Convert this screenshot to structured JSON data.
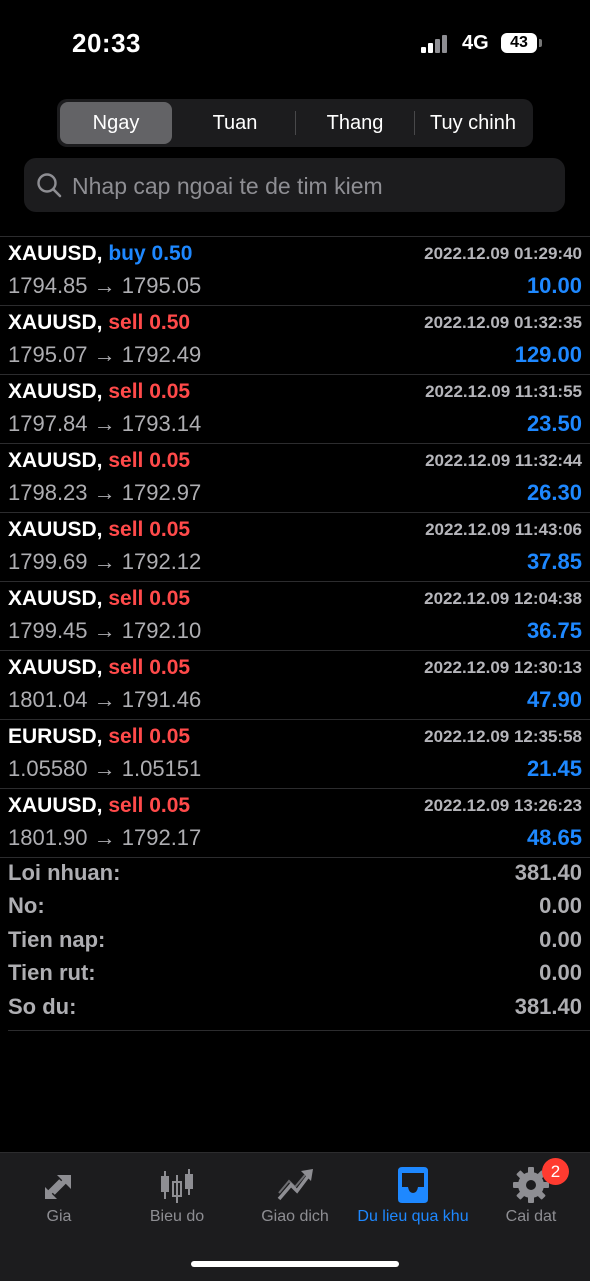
{
  "status_bar": {
    "time": "20:33",
    "network": "4G",
    "battery": "43"
  },
  "period_tabs": [
    {
      "label": "Ngay",
      "active": true
    },
    {
      "label": "Tuan",
      "active": false
    },
    {
      "label": "Thang",
      "active": false
    },
    {
      "label": "Tuy chinh",
      "active": false
    }
  ],
  "search": {
    "placeholder": "Nhap cap ngoai te de tim kiem"
  },
  "trades": [
    {
      "symbol": "XAUUSD,",
      "side": "buy 0.50",
      "side_type": "buy",
      "datetime": "2022.12.09 01:29:40",
      "prices": "1794.85 → 1795.05",
      "profit": "10.00"
    },
    {
      "symbol": "XAUUSD,",
      "side": "sell 0.50",
      "side_type": "sell",
      "datetime": "2022.12.09 01:32:35",
      "prices": "1795.07 → 1792.49",
      "profit": "129.00"
    },
    {
      "symbol": "XAUUSD,",
      "side": "sell 0.05",
      "side_type": "sell",
      "datetime": "2022.12.09 11:31:55",
      "prices": "1797.84 → 1793.14",
      "profit": "23.50"
    },
    {
      "symbol": "XAUUSD,",
      "side": "sell 0.05",
      "side_type": "sell",
      "datetime": "2022.12.09 11:32:44",
      "prices": "1798.23 → 1792.97",
      "profit": "26.30"
    },
    {
      "symbol": "XAUUSD,",
      "side": "sell 0.05",
      "side_type": "sell",
      "datetime": "2022.12.09 11:43:06",
      "prices": "1799.69 → 1792.12",
      "profit": "37.85"
    },
    {
      "symbol": "XAUUSD,",
      "side": "sell 0.05",
      "side_type": "sell",
      "datetime": "2022.12.09 12:04:38",
      "prices": "1799.45 → 1792.10",
      "profit": "36.75"
    },
    {
      "symbol": "XAUUSD,",
      "side": "sell 0.05",
      "side_type": "sell",
      "datetime": "2022.12.09 12:30:13",
      "prices": "1801.04 → 1791.46",
      "profit": "47.90"
    },
    {
      "symbol": "EURUSD,",
      "side": "sell 0.05",
      "side_type": "sell",
      "datetime": "2022.12.09 12:35:58",
      "prices": "1.05580 → 1.05151",
      "profit": "21.45"
    },
    {
      "symbol": "XAUUSD,",
      "side": "sell 0.05",
      "side_type": "sell",
      "datetime": "2022.12.09 13:26:23",
      "prices": "1801.90 → 1792.17",
      "profit": "48.65"
    }
  ],
  "summary": [
    {
      "label": "Loi nhuan:",
      "value": "381.40"
    },
    {
      "label": "No:",
      "value": "0.00"
    },
    {
      "label": "Tien nap:",
      "value": "0.00"
    },
    {
      "label": "Tien rut:",
      "value": "0.00"
    },
    {
      "label": "So du:",
      "value": "381.40"
    }
  ],
  "tab_bar": [
    {
      "label": "Gia",
      "icon": "arrows-icon",
      "active": false
    },
    {
      "label": "Bieu do",
      "icon": "candlestick-icon",
      "active": false
    },
    {
      "label": "Giao dich",
      "icon": "trend-icon",
      "active": false
    },
    {
      "label": "Du lieu qua khu",
      "icon": "inbox-icon",
      "active": true
    },
    {
      "label": "Cai dat",
      "icon": "gear-icon",
      "active": false
    }
  ],
  "settings_badge": "2",
  "colors": {
    "buy": "#1e88ff",
    "sell": "#ff4a4a",
    "profit": "#1e88ff",
    "active_tab": "#1e88ff",
    "badge": "#ff3b30"
  }
}
